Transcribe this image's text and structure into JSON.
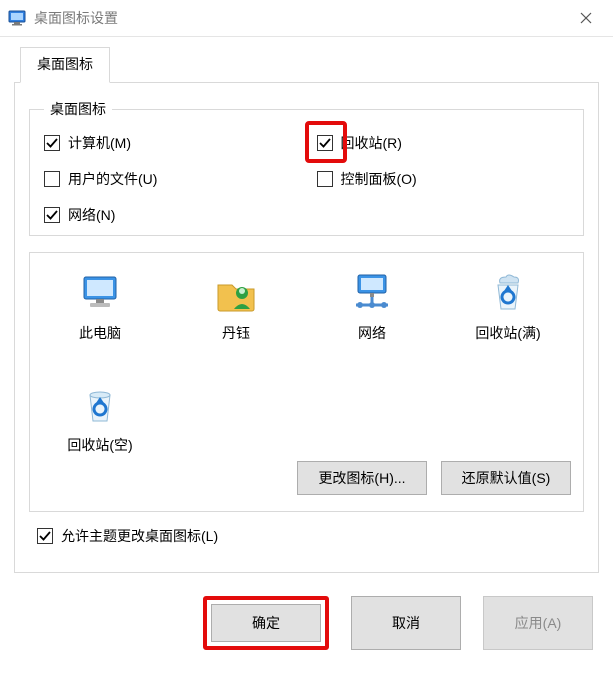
{
  "window": {
    "title": "桌面图标设置"
  },
  "tabs": {
    "active": "桌面图标"
  },
  "group": {
    "legend": "桌面图标",
    "items": {
      "computer": {
        "label": "计算机(M)",
        "checked": true
      },
      "recycle": {
        "label": "回收站(R)",
        "checked": true,
        "highlighted": true
      },
      "userfiles": {
        "label": "用户的文件(U)",
        "checked": false
      },
      "cpanel": {
        "label": "控制面板(O)",
        "checked": false
      },
      "network": {
        "label": "网络(N)",
        "checked": true
      }
    }
  },
  "iconPreview": {
    "row1": [
      {
        "key": "thispc",
        "label": "此电脑",
        "icon": "monitor-icon"
      },
      {
        "key": "user",
        "label": "丹钰",
        "icon": "user-folder-icon"
      },
      {
        "key": "network",
        "label": "网络",
        "icon": "network-icon"
      },
      {
        "key": "recycle-full",
        "label": "回收站(满)",
        "icon": "recycle-full-icon"
      }
    ],
    "row2": [
      {
        "key": "recycle-empty",
        "label": "回收站(空)",
        "icon": "recycle-empty-icon"
      }
    ]
  },
  "panelButtons": {
    "changeIcon": "更改图标(H)...",
    "restoreDefault": "还原默认值(S)"
  },
  "allowTheme": {
    "label": "允许主题更改桌面图标(L)",
    "checked": true
  },
  "dialogButtons": {
    "ok": "确定",
    "cancel": "取消",
    "apply": "应用(A)",
    "okHighlighted": true
  }
}
